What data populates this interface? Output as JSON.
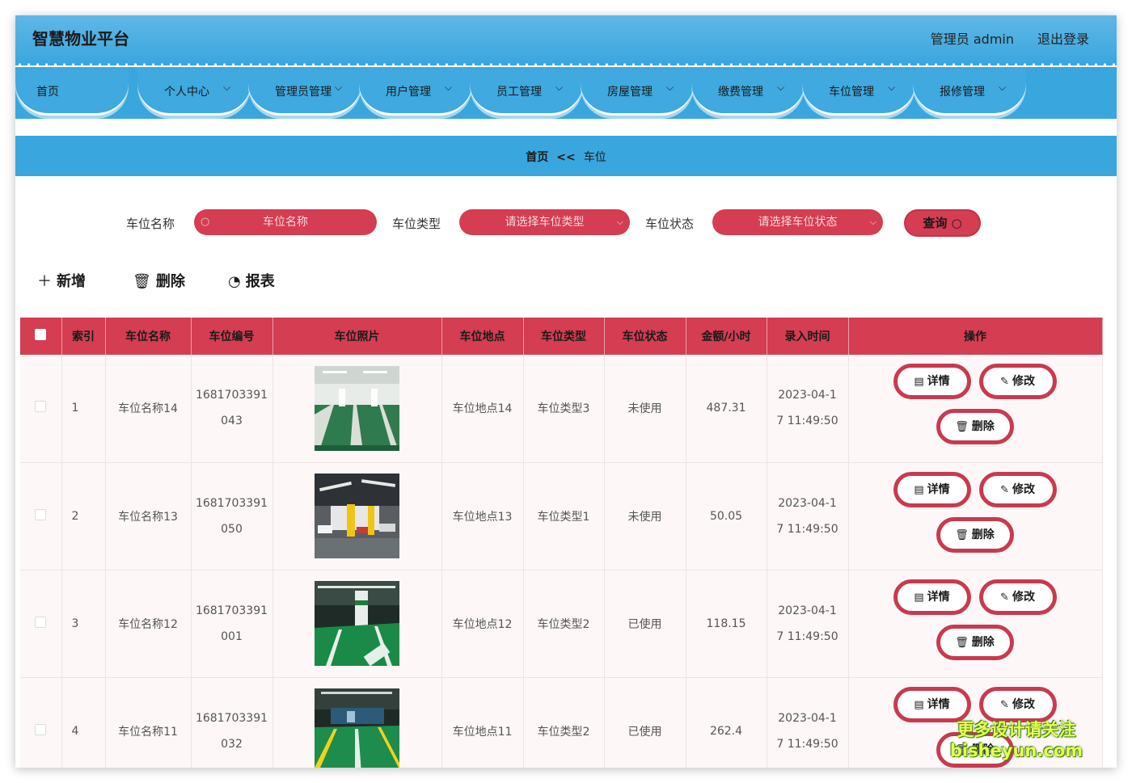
{
  "header": {
    "brand": "智慧物业平台",
    "admin_label": "管理员 admin",
    "logout_label": "退出登录"
  },
  "nav": {
    "items": [
      {
        "label": "首页",
        "has_dropdown": false
      },
      {
        "label": "个人中心",
        "has_dropdown": true
      },
      {
        "label": "管理员管理",
        "has_dropdown": true
      },
      {
        "label": "用户管理",
        "has_dropdown": true
      },
      {
        "label": "员工管理",
        "has_dropdown": true
      },
      {
        "label": "房屋管理",
        "has_dropdown": true
      },
      {
        "label": "缴费管理",
        "has_dropdown": true
      },
      {
        "label": "车位管理",
        "has_dropdown": true
      },
      {
        "label": "报修管理",
        "has_dropdown": true
      }
    ]
  },
  "breadcrumb": {
    "home": "首页",
    "separator": "<<",
    "current": "车位"
  },
  "search": {
    "name_label": "车位名称",
    "name_placeholder": "车位名称",
    "type_label": "车位类型",
    "type_placeholder": "请选择车位类型",
    "status_label": "车位状态",
    "status_placeholder": "请选择车位状态",
    "query_label": "查询"
  },
  "actions": {
    "add_label": "新增",
    "delete_label": "删除",
    "report_label": "报表"
  },
  "table": {
    "headers": {
      "index": "索引",
      "name": "车位名称",
      "code": "车位编号",
      "photo": "车位照片",
      "location": "车位地点",
      "type": "车位类型",
      "status": "车位状态",
      "price": "金额/小时",
      "time": "录入时间",
      "ops": "操作"
    },
    "rows": [
      {
        "index": "1",
        "name": "车位名称14",
        "code_a": "1681703391",
        "code_b": "043",
        "location": "车位地点14",
        "type": "车位类型3",
        "status": "未使用",
        "price": "487.31",
        "time_a": "2023-04-1",
        "time_b": "7 11:49:50"
      },
      {
        "index": "2",
        "name": "车位名称13",
        "code_a": "1681703391",
        "code_b": "050",
        "location": "车位地点13",
        "type": "车位类型1",
        "status": "未使用",
        "price": "50.05",
        "time_a": "2023-04-1",
        "time_b": "7 11:49:50"
      },
      {
        "index": "3",
        "name": "车位名称12",
        "code_a": "1681703391",
        "code_b": "001",
        "location": "车位地点12",
        "type": "车位类型2",
        "status": "已使用",
        "price": "118.15",
        "time_a": "2023-04-1",
        "time_b": "7 11:49:50"
      },
      {
        "index": "4",
        "name": "车位名称11",
        "code_a": "1681703391",
        "code_b": "032",
        "location": "车位地点11",
        "type": "车位类型2",
        "status": "已使用",
        "price": "262.4",
        "time_a": "2023-04-1",
        "time_b": "7 11:49:50"
      }
    ],
    "op_labels": {
      "detail": "详情",
      "edit": "修改",
      "delete": "删除"
    }
  },
  "watermark": {
    "line1": "更多设计请关注",
    "line2": "bisheyun.com"
  },
  "colors": {
    "header_blue": "#3aa6de",
    "accent_red": "#d43d52"
  }
}
